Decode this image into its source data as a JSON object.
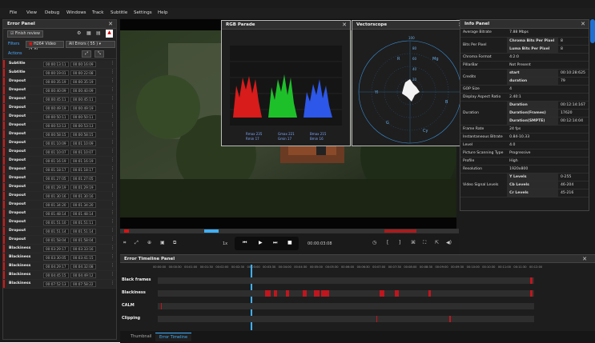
{
  "menu": [
    "File",
    "View",
    "Debug",
    "Windows",
    "Track",
    "Subtitle",
    "Settings",
    "Help"
  ],
  "error_panel": {
    "title": "Error Panel",
    "finish_review": "Finish review",
    "filters_label": "Filters",
    "actions_label": "Actions",
    "track_filter": "H264 Video (1,0)",
    "errors_filter": "All Errors ( 55 )",
    "rows": [
      {
        "type": "Subtitle",
        "in": "00:00:13:11",
        "out": "00:00:16:09"
      },
      {
        "type": "Subtitle",
        "in": "00:00:19:01",
        "out": "00:00:22:08"
      },
      {
        "type": "Dropout",
        "in": "00:00:35:19",
        "out": "00:00:35:19"
      },
      {
        "type": "Dropout",
        "in": "00:00:40:09",
        "out": "00:00:40:09"
      },
      {
        "type": "Dropout",
        "in": "00:00:45:11",
        "out": "00:00:45:11"
      },
      {
        "type": "Dropout",
        "in": "00:00:49:19",
        "out": "00:00:49:19"
      },
      {
        "type": "Dropout",
        "in": "00:00:50:11",
        "out": "00:00:50:11"
      },
      {
        "type": "Dropout",
        "in": "00:00:53:13",
        "out": "00:00:53:13"
      },
      {
        "type": "Dropout",
        "in": "00:00:58:15",
        "out": "00:00:58:15"
      },
      {
        "type": "Dropout",
        "in": "00:01:10:09",
        "out": "00:01:10:09"
      },
      {
        "type": "Dropout",
        "in": "00:01:10:07",
        "out": "00:01:10:07"
      },
      {
        "type": "Dropout",
        "in": "00:01:16:19",
        "out": "00:01:16:19"
      },
      {
        "type": "Dropout",
        "in": "00:01:18:17",
        "out": "00:01:18:17"
      },
      {
        "type": "Dropout",
        "in": "00:01:27:05",
        "out": "00:01:27:05"
      },
      {
        "type": "Dropout",
        "in": "00:01:29:19",
        "out": "00:01:29:19"
      },
      {
        "type": "Dropout",
        "in": "00:01:30:16",
        "out": "00:01:30:16"
      },
      {
        "type": "Dropout",
        "in": "00:01:34:20",
        "out": "00:01:34:20"
      },
      {
        "type": "Dropout",
        "in": "00:01:48:14",
        "out": "00:01:48:14"
      },
      {
        "type": "Dropout",
        "in": "00:01:51:10",
        "out": "00:01:51:11"
      },
      {
        "type": "Dropout",
        "in": "00:01:51:14",
        "out": "00:01:51:14"
      },
      {
        "type": "Dropout",
        "in": "00:01:58:04",
        "out": "00:01:58:04"
      },
      {
        "type": "Blackiness",
        "in": "00:03:29:17",
        "out": "00:03:33:16"
      },
      {
        "type": "Blackiness",
        "in": "00:03:30:05",
        "out": "00:03:41:15"
      },
      {
        "type": "Blackiness",
        "in": "00:04:29:17",
        "out": "00:04:32:08"
      },
      {
        "type": "Blackiness",
        "in": "00:04:45:15",
        "out": "00:04:49:12"
      },
      {
        "type": "Blackiness",
        "in": "00:07:52:13",
        "out": "00:07:58:22"
      }
    ]
  },
  "rgb_parade": {
    "title": "RGB Parade",
    "r_max": "Rmax 235",
    "r_min": "Rmin 17",
    "g_max": "Gmax 221",
    "g_min": "Gmin 17",
    "b_max": "Bmax 215",
    "b_min": "Bmin 16"
  },
  "vectorscope": {
    "title": "Vectorscope",
    "labels": [
      "R",
      "Mg",
      "B",
      "Cy",
      "G",
      "Yl"
    ],
    "ticks": [
      "100",
      "80",
      "60",
      "40",
      "20"
    ]
  },
  "info_panel": {
    "title": "Info Panel",
    "rows": [
      {
        "k": "Average Bitrate",
        "v": "7.88 Mbps"
      },
      {
        "k": "Bits Per Pixel",
        "sub": [
          [
            "Chroma Bits Per Pixel",
            "8"
          ],
          [
            "Luma Bits Per Pixel",
            "8"
          ]
        ]
      },
      {
        "k": "Chroma Format",
        "v": "4:2:0"
      },
      {
        "k": "PillarBar",
        "v": "Not Present"
      },
      {
        "k": "Credits",
        "sub": [
          [
            "start",
            "00:10:28:625"
          ],
          [
            "duration",
            "79"
          ]
        ]
      },
      {
        "k": "GOP Size",
        "v": "4"
      },
      {
        "k": "Display Aspect Ratio",
        "v": "2.40:1"
      },
      {
        "k": "Duration",
        "sub": [
          [
            "Duration",
            "00:12:14:167"
          ],
          [
            "Duration(Frames)",
            "17620"
          ],
          [
            "Duration(SMPTE)",
            "00:12:14:04"
          ]
        ]
      },
      {
        "k": "Frame Rate",
        "v": "24 fps"
      },
      {
        "k": "Instantaneous Bitrate",
        "v": "0.84-10.33"
      },
      {
        "k": "Level",
        "v": "4.0"
      },
      {
        "k": "Picture Scanning Type",
        "v": "Progressive"
      },
      {
        "k": "Profile",
        "v": "High"
      },
      {
        "k": "Resolution",
        "v": "1920x800"
      },
      {
        "k": "Video Signal Levels",
        "sub": [
          [
            "Y Levels",
            "0-255"
          ],
          [
            "Cb Levels",
            "46-204"
          ],
          [
            "Cr Levels",
            "45-216"
          ]
        ]
      }
    ]
  },
  "transport": {
    "speed": "1x",
    "timecode": "00:00:03:08"
  },
  "timeline": {
    "title": "Error Timeline Panel",
    "ticks": [
      "00:00:00",
      "00:00:30",
      "00:01:00",
      "00:01:30",
      "00:02:00",
      "00:02:30",
      "00:03:00",
      "00:03:30",
      "00:04:00",
      "00:04:30",
      "00:05:00",
      "00:05:30",
      "00:06:00",
      "00:06:30",
      "00:07:00",
      "00:07:30",
      "00:08:00",
      "00:08:30",
      "00:09:00",
      "00:09:30",
      "00:10:00",
      "00:10:30",
      "00:11:00",
      "00:11:30",
      "00:12:00"
    ],
    "tracks": [
      {
        "name": "Black frames",
        "marks": [
          [
            0.99,
            0.005
          ]
        ]
      },
      {
        "name": "Blackiness",
        "marks": [
          [
            0.285,
            0.015
          ],
          [
            0.308,
            0.01
          ],
          [
            0.34,
            0.01
          ],
          [
            0.385,
            0.01
          ],
          [
            0.415,
            0.015
          ],
          [
            0.435,
            0.02
          ],
          [
            0.59,
            0.012
          ],
          [
            0.63,
            0.01
          ],
          [
            0.72,
            0.005
          ],
          [
            0.99,
            0.005
          ]
        ]
      },
      {
        "name": "CALM",
        "marks": [
          [
            0.008,
            0.002
          ]
        ]
      },
      {
        "name": "Clipping",
        "marks": [
          [
            0.58,
            0.004
          ],
          [
            0.775,
            0.003
          ]
        ]
      }
    ],
    "tabs": [
      "Thumbnail",
      "Error Timeline"
    ]
  }
}
